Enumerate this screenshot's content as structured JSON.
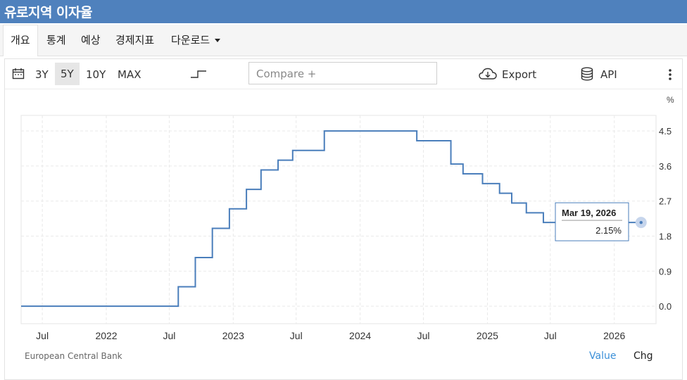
{
  "header": {
    "title": "유로지역 이자율"
  },
  "tabs": [
    "개요",
    "통계",
    "예상",
    "경제지표",
    "다운로드"
  ],
  "toolbar": {
    "ranges": [
      "3Y",
      "5Y",
      "10Y",
      "MAX"
    ],
    "selected_range": "5Y",
    "compare_placeholder": "Compare +",
    "export_label": "Export",
    "api_label": "API"
  },
  "chart_data": {
    "type": "line",
    "unit_label": "%",
    "x_tick_labels": [
      "Jul",
      "2022",
      "Jul",
      "2023",
      "Jul",
      "2024",
      "Jul",
      "2025",
      "Jul",
      "2026"
    ],
    "x_tick_dates": [
      "2021-07-01",
      "2022-01-01",
      "2022-07-01",
      "2023-01-01",
      "2023-07-01",
      "2024-01-01",
      "2024-07-01",
      "2025-01-01",
      "2025-07-01",
      "2026-01-01"
    ],
    "y_ticks": [
      0.0,
      0.9,
      1.8,
      2.7,
      3.6,
      4.5
    ],
    "y_tick_labels": [
      "0.0",
      "0.9",
      "1.8",
      "2.7",
      "3.6",
      "4.5"
    ],
    "ylim": [
      -0.45,
      4.9
    ],
    "xlim": [
      "2021-05-01",
      "2026-05-01"
    ],
    "series": [
      {
        "name": "",
        "color": "#4a7ebb",
        "points": [
          [
            "2021-05-01",
            0.0
          ],
          [
            "2022-07-27",
            0.5
          ],
          [
            "2022-09-14",
            1.25
          ],
          [
            "2022-11-02",
            2.0
          ],
          [
            "2022-12-21",
            2.5
          ],
          [
            "2023-02-08",
            3.0
          ],
          [
            "2023-03-22",
            3.5
          ],
          [
            "2023-05-10",
            3.75
          ],
          [
            "2023-06-21",
            4.0
          ],
          [
            "2023-09-20",
            4.25
          ],
          [
            "2023-09-20",
            4.5
          ],
          [
            "2024-06-12",
            4.25
          ],
          [
            "2024-09-18",
            3.65
          ],
          [
            "2024-10-23",
            3.4
          ],
          [
            "2024-12-18",
            3.15
          ],
          [
            "2025-02-05",
            2.9
          ],
          [
            "2025-03-12",
            2.65
          ],
          [
            "2025-04-23",
            2.4
          ],
          [
            "2025-06-11",
            2.15
          ],
          [
            "2026-03-19",
            2.15
          ]
        ]
      }
    ],
    "tooltip": {
      "date": "Mar 19, 2026",
      "value": "2.15%"
    },
    "source": "European Central Bank",
    "view_toggle": {
      "value_label": "Value",
      "chg_label": "Chg"
    }
  }
}
